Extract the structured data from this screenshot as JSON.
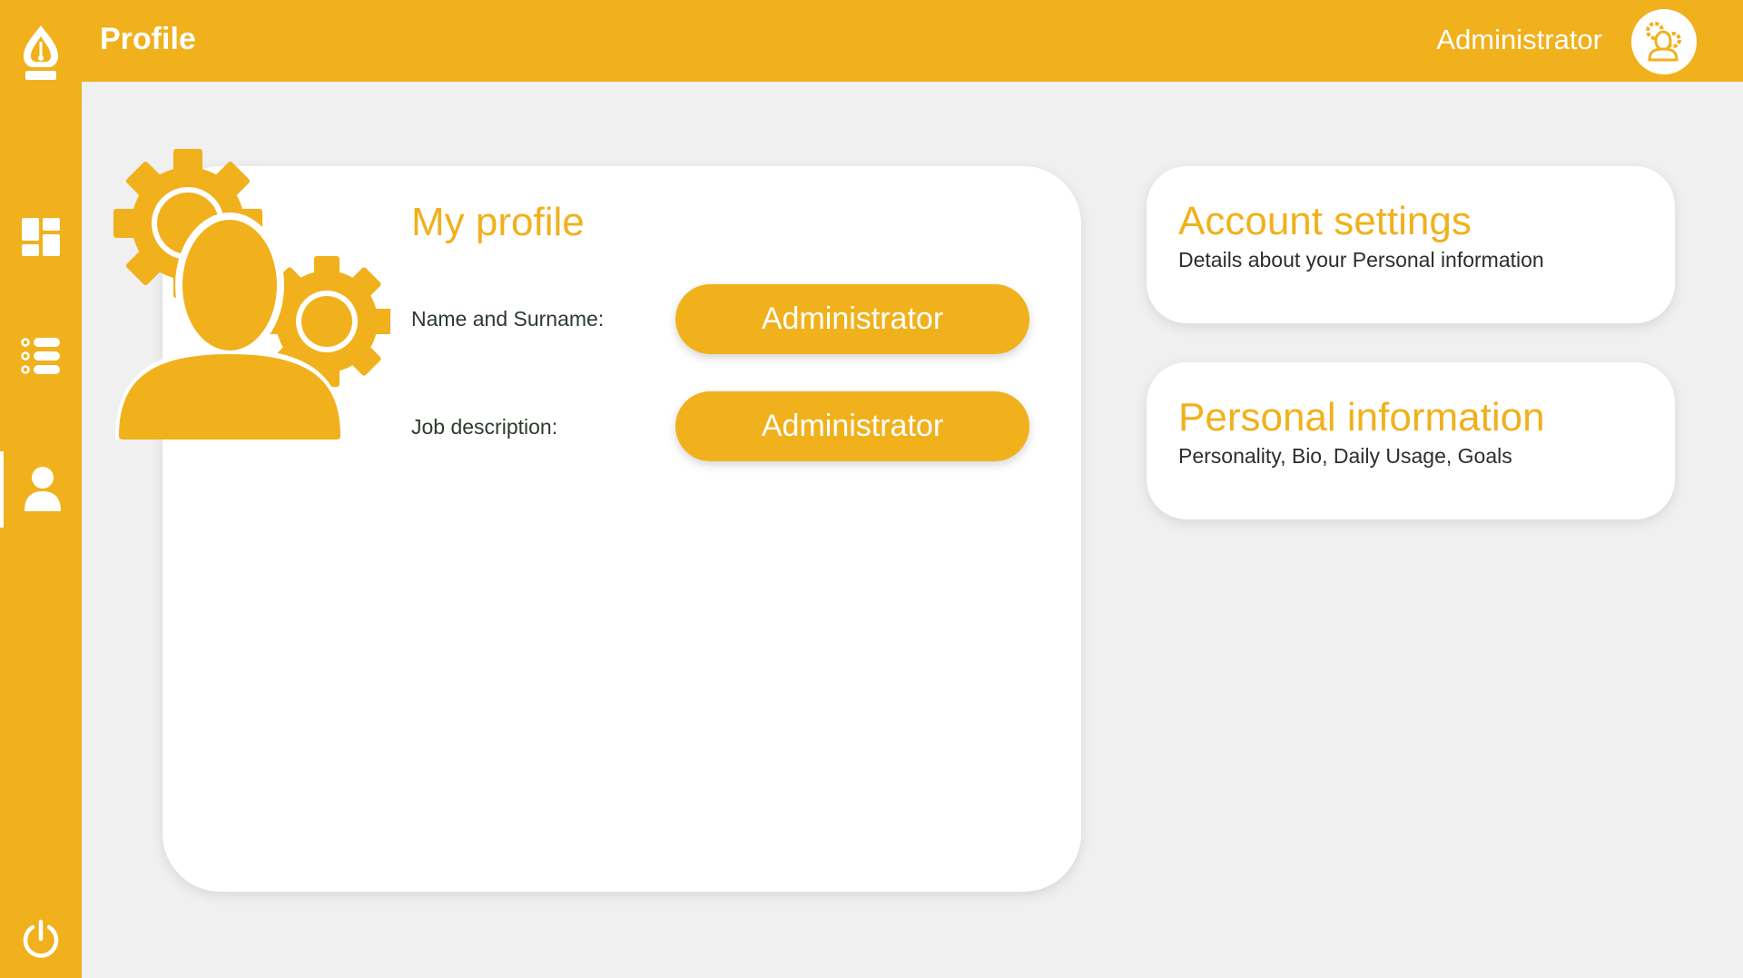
{
  "header": {
    "page_title": "Profile",
    "user_name": "Administrator"
  },
  "sidebar": {
    "items": [
      {
        "icon": "dashboard-icon",
        "active": false
      },
      {
        "icon": "list-icon",
        "active": false
      },
      {
        "icon": "user-icon",
        "active": true
      }
    ],
    "bottom_icon": "power-icon"
  },
  "profile_card": {
    "title": "My profile",
    "fields": [
      {
        "label": "Name and Surname:",
        "value": "Administrator"
      },
      {
        "label": "Job description:",
        "value": "Administrator"
      }
    ]
  },
  "side_cards": [
    {
      "title": "Account settings",
      "subtitle": "Details about your Personal information"
    },
    {
      "title": "Personal information",
      "subtitle": "Personality, Bio, Daily Usage, Goals"
    }
  ],
  "colors": {
    "accent": "#f0b11d",
    "background": "#f0f0f0",
    "card": "#ffffff",
    "label_text": "#2d3a2d"
  }
}
